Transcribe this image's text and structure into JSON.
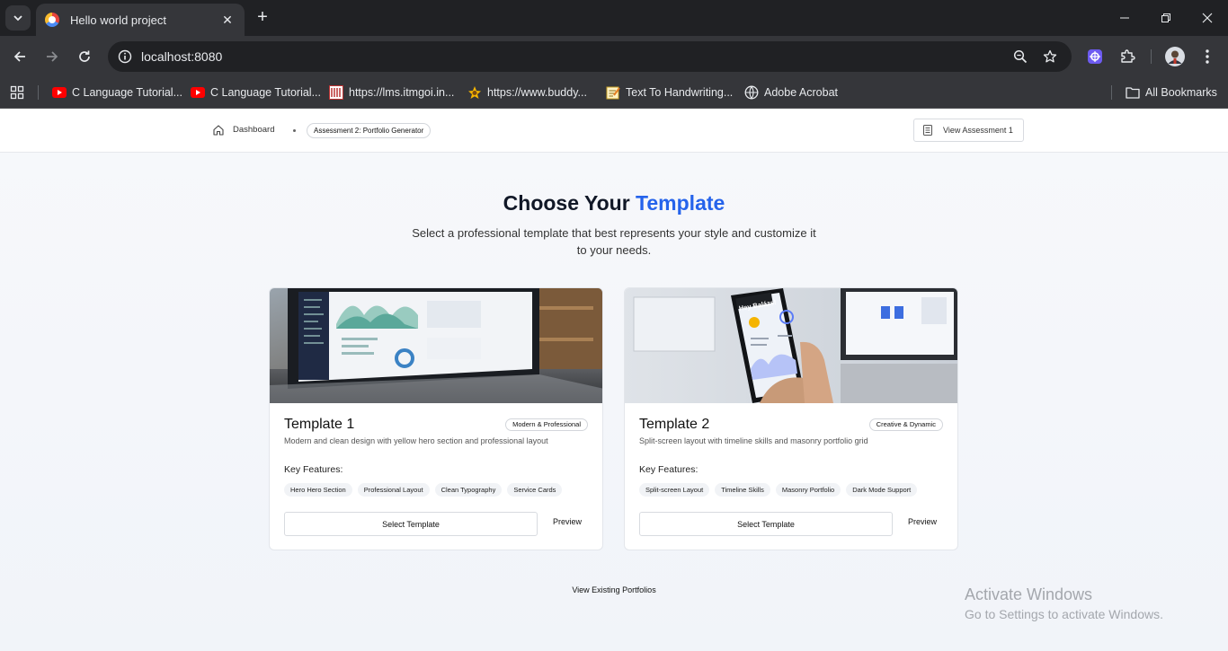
{
  "browser": {
    "tab_title": "Hello world project",
    "url": "localhost:8080",
    "bookmarks": [
      {
        "label": "C Language Tutorial...",
        "icon": "youtube-icon"
      },
      {
        "label": "C Language Tutorial...",
        "icon": "youtube-icon"
      },
      {
        "label": "https://lms.itmgoi.in...",
        "icon": "lms-icon"
      },
      {
        "label": "https://www.buddy...",
        "icon": "buddy-icon"
      },
      {
        "label": "Text To Handwriting...",
        "icon": "note-icon"
      },
      {
        "label": "Adobe Acrobat",
        "icon": "globe-icon"
      }
    ],
    "all_bookmarks": "All Bookmarks"
  },
  "nav": {
    "dashboard": "Dashboard",
    "current": "Assessment 2: Portfolio Generator",
    "view_assessment": "View Assessment 1"
  },
  "hero": {
    "title_main": "Choose Your",
    "title_accent": "Template",
    "subtitle": "Select a professional template that best represents your style and customize it to your needs."
  },
  "templates": [
    {
      "title": "Template 1",
      "tag": "Modern & Professional",
      "description": "Modern and clean design with yellow hero section and professional layout",
      "features_label": "Key Features:",
      "features": [
        "Hero Hero Section",
        "Professional Layout",
        "Clean Typography",
        "Service Cards"
      ],
      "select_label": "Select Template",
      "preview_label": "Preview"
    },
    {
      "title": "Template 2",
      "tag": "Creative & Dynamic",
      "description": "Split-screen layout with timeline skills and masonry portfolio grid",
      "features_label": "Key Features:",
      "features": [
        "Split-screen Layout",
        "Timeline Skills",
        "Masonry Portfolio",
        "Dark Mode Support"
      ],
      "select_label": "Select Template",
      "preview_label": "Preview",
      "image_text": "Hey Balázs!"
    }
  ],
  "footer": {
    "existing": "View Existing Portfolios"
  },
  "watermark": {
    "line1": "Activate Windows",
    "line2": "Go to Settings to activate Windows."
  },
  "colors": {
    "accent": "#2563eb",
    "chrome_dark": "#202124",
    "chrome_mid": "#35363a"
  }
}
